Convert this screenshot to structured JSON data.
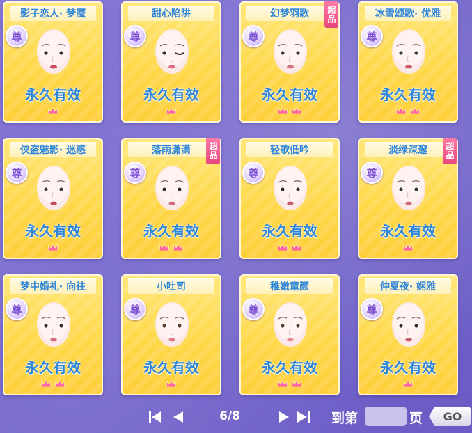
{
  "cards": [
    {
      "name": "影子恋人· 梦魇",
      "badge": "尊",
      "status": "永久有效",
      "super": false,
      "crowns": 1,
      "face": {
        "eye": "#3a2b2b",
        "lip": "#c94a5a",
        "wink": false
      }
    },
    {
      "name": "甜心陷阱",
      "badge": "尊",
      "status": "永久有效",
      "super": false,
      "crowns": 1,
      "face": {
        "eye": "#3a2b2b",
        "lip": "#e06d86",
        "wink": true
      }
    },
    {
      "name": "幻梦羽歌",
      "badge": "尊",
      "status": "永久有效",
      "super": true,
      "super_label": "超品",
      "crowns": 2,
      "face": {
        "eye": "#4a3a2a",
        "lip": "#d5747f",
        "wink": false
      }
    },
    {
      "name": "冰雪颂歌· 优雅",
      "badge": "尊",
      "status": "永久有效",
      "super": false,
      "crowns": 2,
      "face": {
        "eye": "#3b3b3b",
        "lip": "#c85a6a",
        "wink": false
      }
    },
    {
      "name": "侠盗魅影· 迷惑",
      "badge": "尊",
      "status": "永久有效",
      "super": false,
      "crowns": 1,
      "face": {
        "eye": "#4a3b3b",
        "lip": "#c44a5c",
        "wink": false
      }
    },
    {
      "name": "落雨潇潇",
      "badge": "尊",
      "status": "永久有效",
      "super": true,
      "super_label": "超品",
      "crowns": 2,
      "face": {
        "eye": "#3a2b2b",
        "lip": "#d06a7e",
        "wink": false
      }
    },
    {
      "name": "轻歌低吟",
      "badge": "尊",
      "status": "永久有效",
      "super": false,
      "crowns": 2,
      "face": {
        "eye": "#3a2b2b",
        "lip": "#c85a6a",
        "wink": false,
        "elf": true
      }
    },
    {
      "name": "淡绿深邃",
      "badge": "尊",
      "status": "永久有效",
      "super": true,
      "super_label": "超品",
      "crowns": 1,
      "face": {
        "eye": "#2f3a2f",
        "lip": "#d06a7e",
        "wink": false
      }
    },
    {
      "name": "梦中婚礼· 向往",
      "badge": "尊",
      "status": "永久有效",
      "super": false,
      "crowns": 2,
      "face": {
        "eye": "#3a2b2b",
        "lip": "#d06a7e",
        "wink": false
      }
    },
    {
      "name": "小吐司",
      "badge": "尊",
      "status": "永久有效",
      "super": false,
      "crowns": 1,
      "face": {
        "eye": "#5a3a2a",
        "lip": "#e07a86",
        "wink": false
      }
    },
    {
      "name": "稚嫩童颜",
      "badge": "尊",
      "status": "永久有效",
      "super": false,
      "crowns": 2,
      "face": {
        "eye": "#5a3a2a",
        "lip": "#e88a96",
        "wink": false
      }
    },
    {
      "name": "仲夏夜· 娴雅",
      "badge": "尊",
      "status": "永久有效",
      "super": false,
      "crowns": 1,
      "face": {
        "eye": "#3a2b2b",
        "lip": "#c85a6a",
        "wink": false
      }
    }
  ],
  "pager": {
    "page_indicator": "6/8",
    "goto_label": "到第",
    "page_suffix": "页",
    "go_label": "GO",
    "input_value": ""
  },
  "colors": {
    "accent_text": "#2f86d8",
    "card_gold": "#ffd84a",
    "background": "#7466cc",
    "super_tag": "#e8467e"
  },
  "icons": [
    "first-page-icon",
    "prev-page-icon",
    "next-page-icon",
    "last-page-icon",
    "crown-icon"
  ]
}
